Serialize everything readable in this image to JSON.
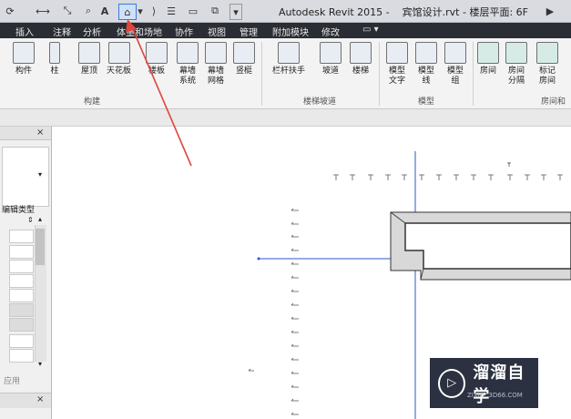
{
  "titlebar": {
    "app": "Autodesk Revit 2015 -",
    "document": "宾馆设计.rvt - 楼层平面: 6F",
    "text_label_glyph": "A"
  },
  "tabs": [
    "插入",
    "注释",
    "分析",
    "体量和场地",
    "协作",
    "视图",
    "管理",
    "附加模块",
    "修改"
  ],
  "ribbon": {
    "build": {
      "title": "构建",
      "buttons": [
        "构件",
        "柱",
        "屋顶",
        "天花板",
        "楼板",
        "幕墙\n系统",
        "幕墙\n网格",
        "竖梃"
      ]
    },
    "stairs": {
      "title": "楼梯坡道",
      "buttons": [
        "栏杆扶手",
        "坡道",
        "楼梯"
      ]
    },
    "model": {
      "title": "模型",
      "buttons": [
        "模型\n文字",
        "模型\n线",
        "模型\n组"
      ]
    },
    "room": {
      "title": "房间和",
      "buttons": [
        "房间",
        "房间\n分隔",
        "标记\n房间"
      ]
    }
  },
  "left_panel": {
    "edit_type_label": "编辑类型",
    "apply_label": "应用",
    "close_glyph": "×"
  },
  "watermark": {
    "brand": "溜溜自学",
    "url": "ZIXUE.3D66.COM"
  },
  "colors": {
    "accent_arrow": "#e0463c",
    "tab_bar": "#2a2d33",
    "title_bar": "#d9dbe0",
    "grid_line": "#2a58c9",
    "wall_fill": "#d8d8d8"
  }
}
